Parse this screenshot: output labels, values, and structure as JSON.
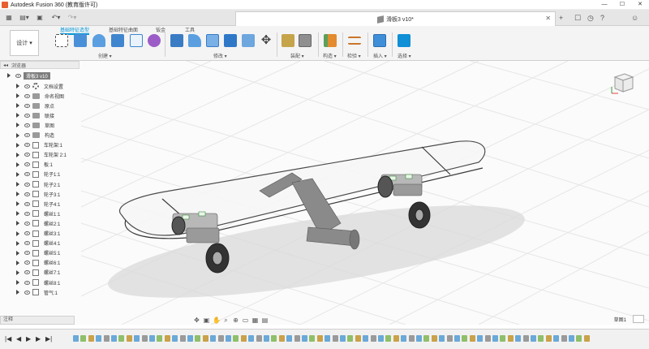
{
  "window": {
    "title": "Autodesk Fusion 360 (教育版许可)",
    "controls": [
      "—",
      "☐",
      "✕"
    ]
  },
  "document_tab": {
    "title": "滑板3 v10*",
    "close": "✕",
    "right_icons": [
      "+",
      "☐",
      "◷",
      "?",
      "☺"
    ]
  },
  "ribbon": {
    "workspace": "设计 ▾",
    "tabs": [
      {
        "label": "基础特征造型",
        "active": true
      },
      {
        "label": "基础特征曲面",
        "active": false
      },
      {
        "label": "钣金",
        "active": false
      },
      {
        "label": "工具",
        "active": false
      }
    ],
    "groups": [
      "创建 ▾",
      "修改 ▾",
      "装配 ▾",
      "构造 ▾",
      "检验 ▾",
      "插入 ▾",
      "选择 ▾"
    ]
  },
  "browser": {
    "header": "浏览器",
    "root": "滑板3 v10",
    "items": [
      {
        "label": "文档设置",
        "kind": "gear"
      },
      {
        "label": "命名视图",
        "kind": "folder"
      },
      {
        "label": "原点",
        "kind": "folder"
      },
      {
        "label": "联接",
        "kind": "folder"
      },
      {
        "label": "草图",
        "kind": "folder"
      },
      {
        "label": "构造",
        "kind": "folder"
      },
      {
        "label": "车轮架:1",
        "kind": "comp"
      },
      {
        "label": "车轮架 2:1",
        "kind": "comp"
      },
      {
        "label": "板:1",
        "kind": "comp"
      },
      {
        "label": "轮子1:1",
        "kind": "comp"
      },
      {
        "label": "轮子2:1",
        "kind": "comp"
      },
      {
        "label": "轮子3:1",
        "kind": "comp"
      },
      {
        "label": "轮子4:1",
        "kind": "comp"
      },
      {
        "label": "螺丝1:1",
        "kind": "comp"
      },
      {
        "label": "螺丝2:1",
        "kind": "comp"
      },
      {
        "label": "螺丝3:1",
        "kind": "comp"
      },
      {
        "label": "螺丝4:1",
        "kind": "comp"
      },
      {
        "label": "螺丝5:1",
        "kind": "comp"
      },
      {
        "label": "螺丝6:1",
        "kind": "comp"
      },
      {
        "label": "螺丝7:1",
        "kind": "comp"
      },
      {
        "label": "螺丝8:1",
        "kind": "comp"
      },
      {
        "label": "管气:1",
        "kind": "comp"
      }
    ]
  },
  "bottom": {
    "comments": "注释",
    "selection": "草图1"
  },
  "timeline": {
    "controls": [
      "|◀",
      "◀",
      "▶",
      "▶",
      "▶|"
    ]
  },
  "colors": {
    "accent": "#0696d7",
    "timeline_feature": "#6aa9d8",
    "model_line": "#3a3a3a"
  }
}
